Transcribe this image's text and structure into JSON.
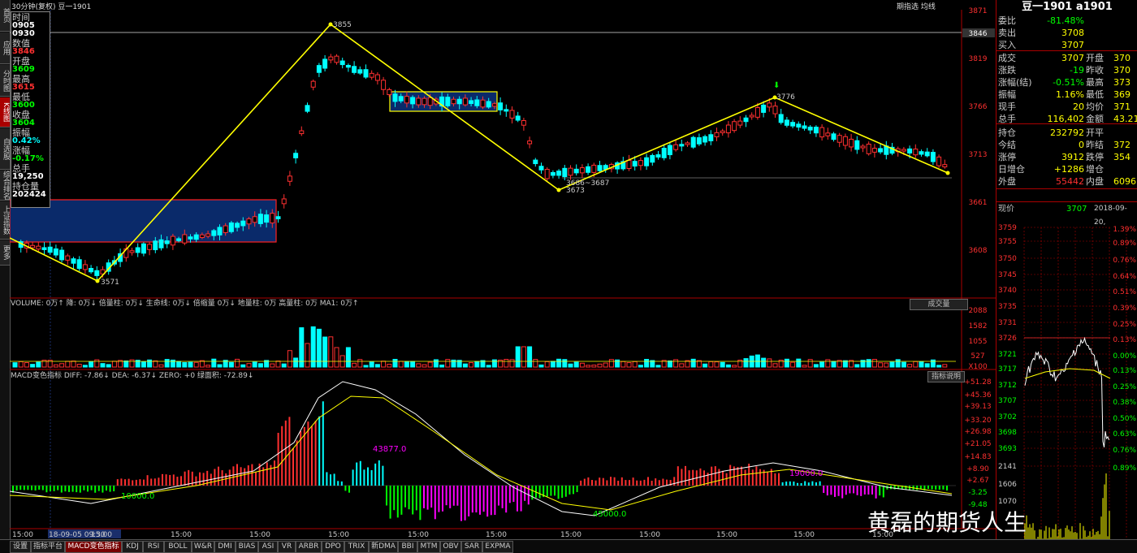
{
  "header": {
    "title": "30分钟(复权)  豆一1901",
    "right_links": "期指选 均线"
  },
  "sidebar": [
    "首页",
    "应用",
    "分时图",
    "K线图",
    "自选股",
    "综合排名",
    "上证指数",
    "更多"
  ],
  "infobox": [
    {
      "label": "时间",
      "value": "0905\n0930",
      "value_color": "#ffffff"
    },
    {
      "label": "数值",
      "value": "3846",
      "value_color": "#ff3030"
    },
    {
      "label": "开盘",
      "value": "3609",
      "value_color": "#00ff00"
    },
    {
      "label": "最高",
      "value": "3615",
      "value_color": "#ff3030"
    },
    {
      "label": "最低",
      "value": "3600",
      "value_color": "#00ff00"
    },
    {
      "label": "收盘",
      "value": "3604",
      "value_color": "#00ff00"
    },
    {
      "label": "振幅",
      "value": "0.42%",
      "value_color": "#00ffff"
    },
    {
      "label": "涨幅",
      "value": "-0.17%",
      "value_color": "#00ff00"
    },
    {
      "label": "总手",
      "value": "19,250",
      "value_color": "#ffffff"
    },
    {
      "label": "持仓量",
      "value": "202424",
      "value_color": "#ffffff"
    }
  ],
  "price_axis": [
    "3871",
    "3846",
    "3819",
    "3766",
    "3713",
    "3661",
    "3608"
  ],
  "annotations": [
    "3855",
    "3571",
    "3776",
    "3686~3687",
    "3673"
  ],
  "volume_legend": "VOLUME: 0万↑ 降: 0万↓ 倍量柱: 0万↓ 生命线: 0万↓ 倍缩量 0万↓ 地量柱: 0万 高量柱: 0万 MA1: 0万↑",
  "volume_tab": "成交量",
  "volume_axis": [
    "2088",
    "1582",
    "1055",
    "527",
    "X100"
  ],
  "macd_legend": "MACD变色指标 DIFF: -7.86↓ DEA: -6.37↓ ZERO: +0 绿面积: -72.89↓",
  "macd_button": "指标说明",
  "macd_axis": [
    "+51.28",
    "+45.36",
    "+39.13",
    "+33.20",
    "+26.98",
    "+21.05",
    "+14.83",
    "+8.90",
    "+2.67",
    "-3.25",
    "-9.48"
  ],
  "macd_labels": [
    "43877.0",
    "10000.0",
    "45000.0",
    "19000.0"
  ],
  "time_axis": [
    "15:00",
    "18-09-05 09:30",
    "15:00",
    "15:00",
    "15:00",
    "15:00",
    "15:00",
    "15:00",
    "15:00",
    "15:00",
    "15:00",
    "15:00",
    "15:00"
  ],
  "right_panel": {
    "title": "豆一1901 a1901",
    "rows": [
      [
        "委比",
        "-81.48%",
        "",
        ""
      ],
      [
        "卖出",
        "3708",
        "",
        ""
      ],
      [
        "买入",
        "3707",
        "",
        ""
      ],
      [
        "成交",
        "3707",
        "开盘",
        "370"
      ],
      [
        "涨跌",
        "-19",
        "昨收",
        "370"
      ],
      [
        "涨幅(结)",
        "-0.51%",
        "最高",
        "373"
      ],
      [
        "振幅",
        "1.16%",
        "最低",
        "369"
      ],
      [
        "现手",
        "20",
        "均价",
        "371"
      ],
      [
        "总手",
        "116,402",
        "金额",
        "43.21"
      ],
      [
        "持仓",
        "232792",
        "开平",
        ""
      ],
      [
        "今结",
        "0",
        "昨结",
        "372"
      ],
      [
        "涨停",
        "3912",
        "跌停",
        "354"
      ],
      [
        "日增仓",
        "+1286",
        "增仓",
        ""
      ],
      [
        "外盘",
        "55442",
        "内盘",
        "6096"
      ]
    ],
    "current_label": "现价",
    "current_price": "3707",
    "current_date": "2018-09-20,",
    "mini_axis_left": [
      "3759",
      "3755",
      "3750",
      "3745",
      "3740",
      "3735",
      "3731",
      "3726",
      "3721",
      "3717",
      "3712",
      "3707",
      "3702",
      "3698",
      "3693",
      "2141",
      "1606",
      "1070"
    ],
    "mini_axis_right": [
      "1.39%",
      "0.89%",
      "0.76%",
      "0.64%",
      "0.51%",
      "0.39%",
      "0.25%",
      "0.13%",
      "0.00%",
      "0.13%",
      "0.25%",
      "0.38%",
      "0.50%",
      "0.63%",
      "0.76%",
      "0.89%"
    ],
    "tab_label": "分"
  },
  "bottom_tabs": [
    "设置",
    "指标平台",
    "MACD变色指标",
    "KDJ",
    "RSI",
    "BOLL",
    "W&R",
    "DMI",
    "BIAS",
    "ASI",
    "VR",
    "ARBR",
    "DPO",
    "TRIX",
    "新DMA",
    "BBI",
    "MTM",
    "OBV",
    "SAR",
    "EXPMA"
  ],
  "watermark": "黄磊的期货人生",
  "colors": {
    "up": "#ff3030",
    "down": "#00ffff",
    "trend": "#ffff00",
    "box": "#0a2a6a"
  }
}
